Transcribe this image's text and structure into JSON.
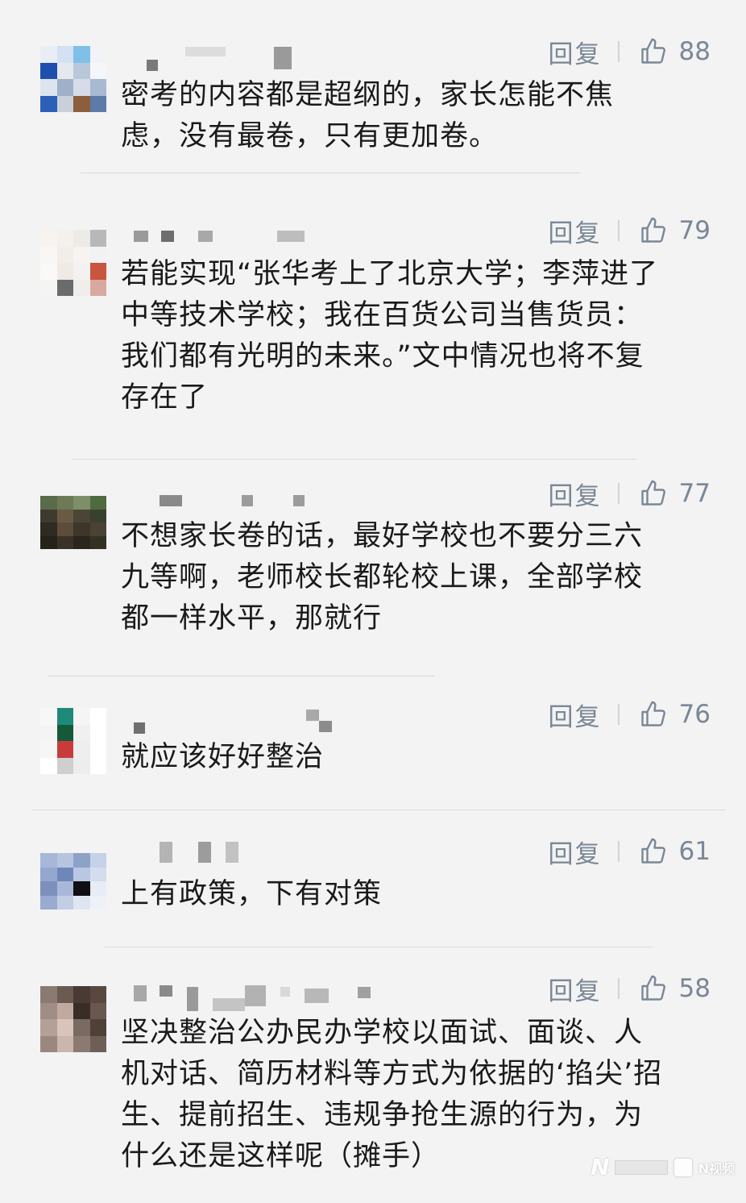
{
  "ui": {
    "reply_label": "回复"
  },
  "comments": [
    {
      "likes": "88",
      "text_lines": [
        "密考的内容都是超纲的，家长怎能不焦",
        "虑，没有最卷，只有更加卷。"
      ]
    },
    {
      "likes": "79",
      "text_lines": [
        "若能实现“张华考上了北京大学；李萍进了",
        "中等技术学校；我在百货公司当售货员：",
        "我们都有光明的未来。”文中情况也将不复",
        "存在了"
      ]
    },
    {
      "likes": "77",
      "text_lines": [
        "不想家长卷的话，最好学校也不要分三六",
        "九等啊，老师校长都轮校上课，全部学校",
        "都一样水平，那就行"
      ]
    },
    {
      "likes": "76",
      "text_lines": [
        "就应该好好整治"
      ]
    },
    {
      "likes": "61",
      "text_lines": [
        "上有政策，下有对策"
      ]
    },
    {
      "likes": "58",
      "text_lines": [
        "坚决整治公办民办学校以面试、面谈、人",
        "机对话、简历材料等方式为依据的‘掐尖’招",
        "生、提前招生、违规争抢生源的行为，为",
        "什么还是这样呢（摊手）"
      ]
    }
  ],
  "colors": {
    "background": "#f3f3f3",
    "text": "#1a1a1a",
    "action_gray": "#7a8796"
  },
  "icons": {
    "like": "thumbs-up-icon"
  },
  "watermark": {
    "left": "N",
    "right": "N视频"
  }
}
